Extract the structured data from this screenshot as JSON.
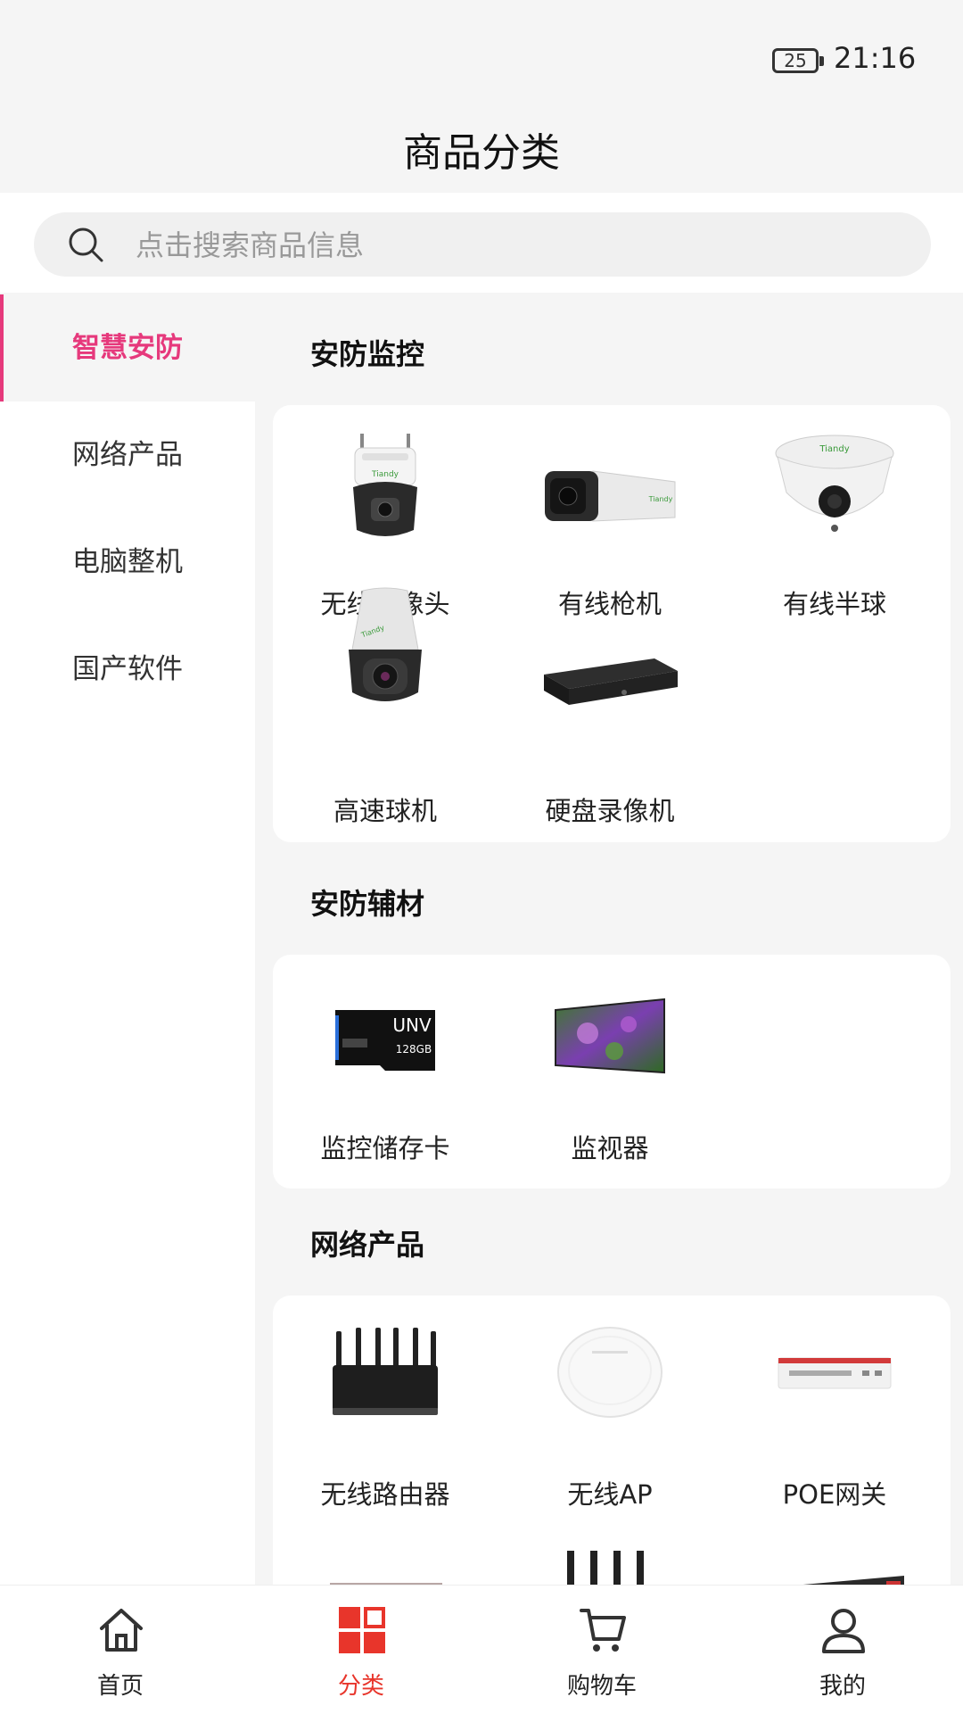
{
  "status_bar": {
    "battery": "25",
    "time": "21:16"
  },
  "header": {
    "title": "商品分类"
  },
  "search": {
    "placeholder": "点击搜索商品信息"
  },
  "sidebar": {
    "items": [
      {
        "label": "智慧安防",
        "active": true
      },
      {
        "label": "网络产品",
        "active": false
      },
      {
        "label": "电脑整机",
        "active": false
      },
      {
        "label": "国产软件",
        "active": false
      }
    ]
  },
  "sections": [
    {
      "title": "安防监控",
      "items": [
        {
          "label": "无线摄像头",
          "icon": "wireless-camera"
        },
        {
          "label": "有线枪机",
          "icon": "bullet-camera"
        },
        {
          "label": "有线半球",
          "icon": "dome-camera"
        },
        {
          "label": "高速球机",
          "icon": "speed-dome"
        },
        {
          "label": "硬盘录像机",
          "icon": "nvr"
        }
      ]
    },
    {
      "title": "安防辅材",
      "items": [
        {
          "label": "监控储存卡",
          "icon": "memory-card"
        },
        {
          "label": "监视器",
          "icon": "monitor"
        }
      ]
    },
    {
      "title": "网络产品",
      "items": [
        {
          "label": "无线路由器",
          "icon": "router"
        },
        {
          "label": "无线AP",
          "icon": "access-point"
        },
        {
          "label": "POE网关",
          "icon": "poe-gateway"
        }
      ]
    }
  ],
  "brand_marks": {
    "camera_brand": "Tiandy",
    "card_brand": "UNV",
    "card_capacity": "128GB"
  },
  "tabbar": {
    "items": [
      {
        "label": "首页",
        "icon": "home-icon",
        "active": false
      },
      {
        "label": "分类",
        "icon": "category-icon",
        "active": true
      },
      {
        "label": "购物车",
        "icon": "cart-icon",
        "active": false
      },
      {
        "label": "我的",
        "icon": "profile-icon",
        "active": false
      }
    ]
  },
  "colors": {
    "accent_pink": "#e6397c",
    "active_tab_red": "#e8352b",
    "background": "#f5f5f5"
  }
}
